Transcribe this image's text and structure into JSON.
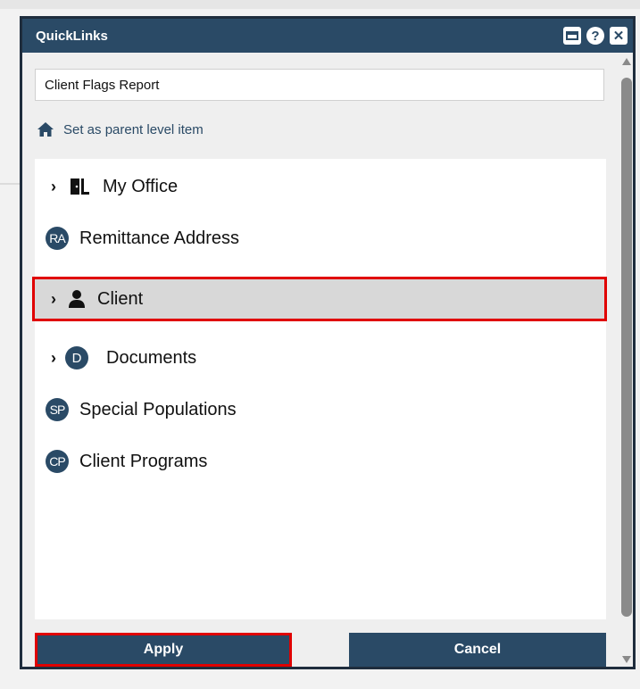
{
  "dialog": {
    "title": "QuickLinks",
    "name_value": "Client Flags Report",
    "parent_link": "Set as parent level item"
  },
  "tree": {
    "items": [
      {
        "label": "My Office",
        "icon": "door-icon",
        "expandable": true
      },
      {
        "label": "Remittance Address",
        "badge": "RA",
        "expandable": false
      },
      {
        "label": "Client",
        "icon": "person-icon",
        "expandable": true,
        "selected": true
      },
      {
        "label": "Documents",
        "badge": "D",
        "expandable": true
      },
      {
        "label": "Special Populations",
        "badge": "SP",
        "expandable": false
      },
      {
        "label": "Client Programs",
        "badge": "CP",
        "expandable": false
      }
    ]
  },
  "buttons": {
    "apply": "Apply",
    "cancel": "Cancel"
  },
  "colors": {
    "header": "#2a4a66",
    "highlight": "#e00000",
    "selected_bg": "#d8d8d8"
  }
}
